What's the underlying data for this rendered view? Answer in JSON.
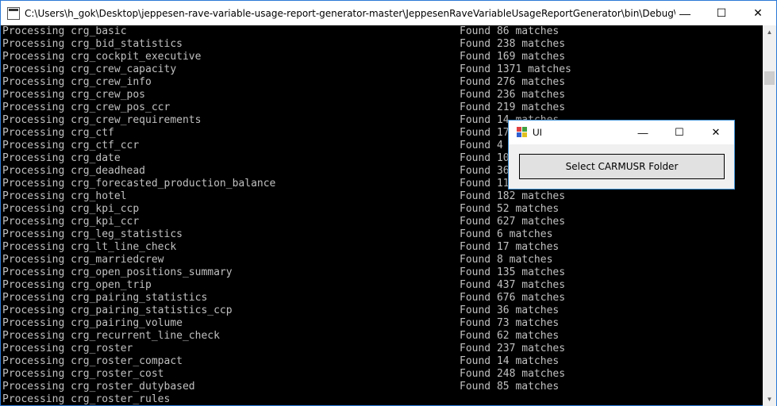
{
  "console": {
    "title": "C:\\Users\\h_gok\\Desktop\\jeppesen-rave-variable-usage-report-generator-master\\JeppesenRaveVariableUsageReportGenerator\\bin\\Debug\\JeppesenRav...",
    "controls": {
      "minimize": "—",
      "maximize": "☐",
      "close": "✕"
    },
    "lines": [
      {
        "proc": "Processing crg_basic",
        "found": "Found 86 matches"
      },
      {
        "proc": "Processing crg_bid_statistics",
        "found": "Found 238 matches"
      },
      {
        "proc": "Processing crg_cockpit_executive",
        "found": "Found 169 matches"
      },
      {
        "proc": "Processing crg_crew_capacity",
        "found": "Found 1371 matches"
      },
      {
        "proc": "Processing crg_crew_info",
        "found": "Found 276 matches"
      },
      {
        "proc": "Processing crg_crew_pos",
        "found": "Found 236 matches"
      },
      {
        "proc": "Processing crg_crew_pos_ccr",
        "found": "Found 219 matches"
      },
      {
        "proc": "Processing crg_crew_requirements",
        "found": "Found 14 matches"
      },
      {
        "proc": "Processing crg_ctf",
        "found": "Found 17"
      },
      {
        "proc": "Processing crg_ctf_ccr",
        "found": "Found 4"
      },
      {
        "proc": "Processing crg_date",
        "found": "Found 10"
      },
      {
        "proc": "Processing crg_deadhead",
        "found": "Found 36"
      },
      {
        "proc": "Processing crg_forecasted_production_balance",
        "found": "Found 11"
      },
      {
        "proc": "Processing crg_hotel",
        "found": "Found 182 matches"
      },
      {
        "proc": "Processing crg_kpi_ccp",
        "found": "Found 52 matches"
      },
      {
        "proc": "Processing crg_kpi_ccr",
        "found": "Found 627 matches"
      },
      {
        "proc": "Processing crg_leg_statistics",
        "found": "Found 6 matches"
      },
      {
        "proc": "Processing crg_lt_line_check",
        "found": "Found 17 matches"
      },
      {
        "proc": "Processing crg_marriedcrew",
        "found": "Found 8 matches"
      },
      {
        "proc": "Processing crg_open_positions_summary",
        "found": "Found 135 matches"
      },
      {
        "proc": "Processing crg_open_trip",
        "found": "Found 437 matches"
      },
      {
        "proc": "Processing crg_pairing_statistics",
        "found": "Found 676 matches"
      },
      {
        "proc": "Processing crg_pairing_statistics_ccp",
        "found": "Found 36 matches"
      },
      {
        "proc": "Processing crg_pairing_volume",
        "found": "Found 73 matches"
      },
      {
        "proc": "Processing crg_recurrent_line_check",
        "found": "Found 62 matches"
      },
      {
        "proc": "Processing crg_roster",
        "found": "Found 237 matches"
      },
      {
        "proc": "Processing crg_roster_compact",
        "found": "Found 14 matches"
      },
      {
        "proc": "Processing crg_roster_cost",
        "found": "Found 248 matches"
      },
      {
        "proc": "Processing crg_roster_dutybased",
        "found": "Found 85 matches"
      },
      {
        "proc": "Processing crg_roster_rules",
        "found": ""
      }
    ]
  },
  "scrollbar": {
    "up_arrow": "▲",
    "down_arrow": "▼"
  },
  "dialog": {
    "title": "UI",
    "controls": {
      "minimize": "—",
      "maximize": "☐",
      "close": "✕"
    },
    "select_button_label": "Select CARMUSR Folder"
  },
  "colors": {
    "console_bg": "#000000",
    "console_text": "#c0c0c0",
    "dialog_bg": "#f0f0f0",
    "accent_border": "#3c8fd4"
  }
}
